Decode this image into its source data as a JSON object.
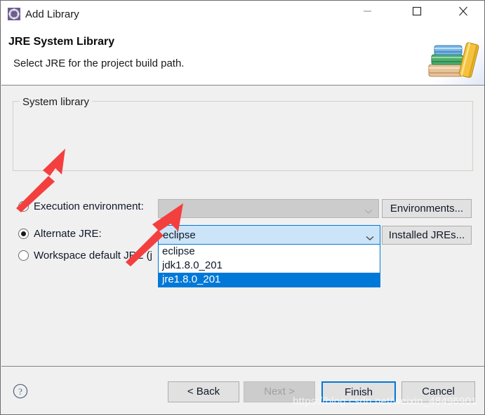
{
  "window": {
    "title": "Add Library",
    "icon": "library-gear-icon",
    "controls": {
      "minimize": "minimize-icon",
      "maximize": "maximize-icon",
      "close": "close-icon"
    }
  },
  "header": {
    "title": "JRE System Library",
    "subtitle": "Select JRE for the project build path.",
    "banner_icon": "books-stack-icon"
  },
  "main": {
    "group": {
      "label": "System library",
      "options": [
        {
          "label": "Execution environment:",
          "selected": false
        },
        {
          "label": "Alternate JRE:",
          "selected": true
        },
        {
          "label": "Workspace default JRE (j",
          "selected": false
        }
      ],
      "execution_environment_combo": {
        "value": "",
        "placeholder": "",
        "enabled": false
      },
      "alternate_jre_combo": {
        "value": "eclipse",
        "expanded": true,
        "options": [
          {
            "label": "eclipse",
            "highlighted": false
          },
          {
            "label": "jdk1.8.0_201",
            "highlighted": false
          },
          {
            "label": "jre1.8.0_201",
            "highlighted": true
          }
        ]
      },
      "side_buttons": [
        {
          "label": "Environments...",
          "enabled": false
        },
        {
          "label": "Installed JREs...",
          "enabled": true
        }
      ]
    }
  },
  "footer": {
    "help_icon": "help-question-icon",
    "buttons": [
      {
        "label": "< Back",
        "enabled": true,
        "default": false
      },
      {
        "label": "Next >",
        "enabled": false,
        "default": false
      },
      {
        "label": "Finish",
        "enabled": true,
        "default": true
      },
      {
        "label": "Cancel",
        "enabled": true,
        "default": false
      }
    ]
  },
  "annotations": {
    "arrows": [
      {
        "name": "arrow-to-alternate-jre-radio",
        "color": "#f43f3f"
      },
      {
        "name": "arrow-to-jre-dropdown-item",
        "color": "#f43f3f"
      }
    ],
    "watermark": "https://blog.csdn.net/weixin_48496901"
  },
  "colors": {
    "accent": "#0078d7",
    "dialog_bg": "#f0f0f0",
    "header_bg": "#ffffff",
    "annotation": "#f43f3f"
  }
}
